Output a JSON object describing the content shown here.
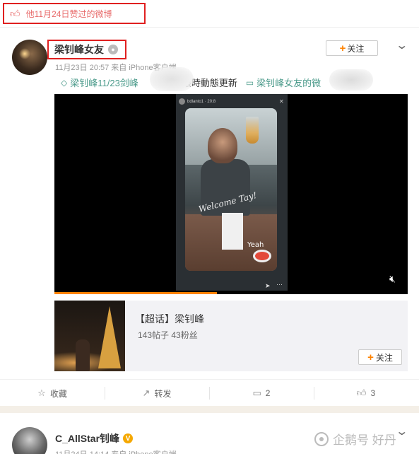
{
  "liked_banner": {
    "icon": "thumbs-up-icon",
    "text": "他11月24日赞过的微博"
  },
  "post": {
    "author": "梁钊峰女友",
    "badge_icon": "robot-badge-icon",
    "follow_label": "关注",
    "meta": "11月23日 20:57 来自 iPhone客户端",
    "topics": [
      {
        "icon": "diamond-link-icon",
        "text": "梁钊峰11/23剑峰"
      },
      {
        "text": "限時動態更新"
      },
      {
        "icon": "video-link-icon",
        "text": "梁钊峰女友的微"
      }
    ],
    "video": {
      "progress_fraction": 0.46,
      "story_user": "bdlanto1 · 20:8",
      "welcome_text": "Welcome Tay!",
      "yeah_text": "Yeah",
      "mute_icon": "mute-icon",
      "close_icon": "close-icon",
      "send_icon": "send-icon",
      "more_icon": "more-icon"
    },
    "topic_card": {
      "title": "【超话】梁钊峰",
      "stats": "143帖子 43粉丝",
      "follow_label": "关注"
    },
    "actions": [
      {
        "icon": "star-icon",
        "label": "收藏"
      },
      {
        "icon": "share-icon",
        "label": "转发"
      },
      {
        "icon": "comment-icon",
        "label": "2"
      },
      {
        "icon": "like-icon",
        "label": "3"
      }
    ]
  },
  "next_post": {
    "author": "C_AllStar钊峰",
    "verified_mark": "V",
    "meta": "11月24日 14:14 来自 iPhone客户端"
  },
  "watermark": {
    "text": "企鹅号 好丹"
  },
  "colors": {
    "accent": "#ff8200",
    "highlight_red": "#e02020",
    "topic_green": "#4a9a8a"
  }
}
